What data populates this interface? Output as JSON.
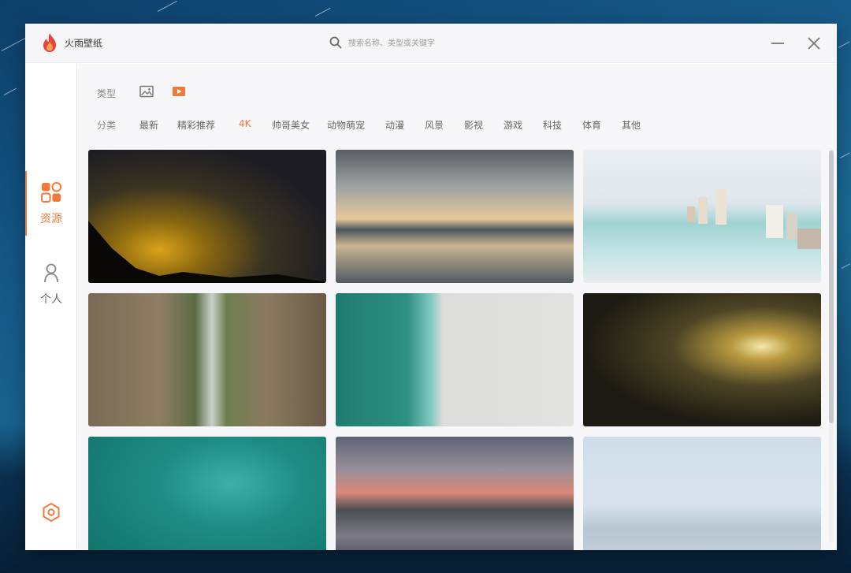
{
  "app": {
    "name": "火雨壁纸"
  },
  "search": {
    "placeholder": "搜索名称、类型或关键字"
  },
  "sidebar": {
    "items": [
      {
        "label": "资源",
        "icon": "grid-icon",
        "active": true
      },
      {
        "label": "个人",
        "icon": "user-icon",
        "active": false
      }
    ],
    "settings_icon": "settings-icon"
  },
  "filters": {
    "type_label": "类型",
    "types": [
      {
        "icon": "image-icon",
        "active": false
      },
      {
        "icon": "video-icon",
        "active": true
      }
    ],
    "category_label": "分类",
    "categories": [
      "最新",
      "精彩推荐",
      "4K",
      "帅哥美女",
      "动物萌宠",
      "动漫",
      "风景",
      "影视",
      "游戏",
      "科技",
      "体育",
      "其他"
    ],
    "active_category": "4K"
  },
  "thumbnails": [
    {
      "subject": "starry-night-mountain-thumbnail"
    },
    {
      "subject": "sunset-lake-reflection-thumbnail"
    },
    {
      "subject": "coastal-city-beach-thumbnail"
    },
    {
      "subject": "cliff-waterfall-thumbnail"
    },
    {
      "subject": "aerial-beach-shore-thumbnail"
    },
    {
      "subject": "forest-sunlight-thumbnail"
    },
    {
      "subject": "surfers-ocean-thumbnail"
    },
    {
      "subject": "dusk-lake-hills-thumbnail"
    },
    {
      "subject": "misty-sea-pier-thumbnail"
    }
  ],
  "colors": {
    "accent": "#f07a3c",
    "logo": "#e8423c"
  }
}
